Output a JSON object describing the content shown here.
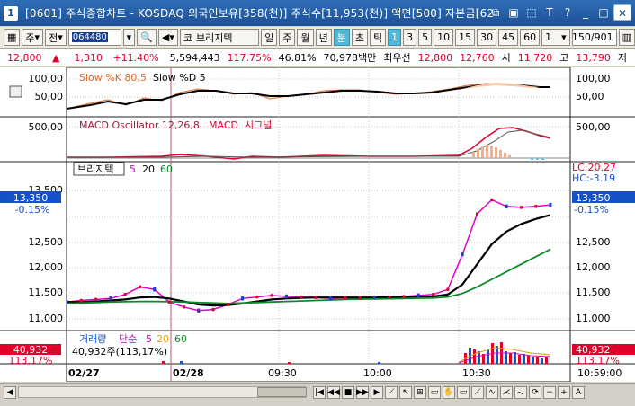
{
  "window": {
    "title": "[0601] 주식종합차트 - KOSDAQ 외국인보유[358(천)] 주식수[11,953(천)] 액면[500] 자본금[62",
    "icon_label": "1"
  },
  "toolbar": {
    "market": "주",
    "all": "전",
    "code": "064480",
    "stock_name": "브리지텍",
    "market_prefix": "코",
    "periods": [
      "일",
      "주",
      "월",
      "년",
      "분",
      "초",
      "틱"
    ],
    "selected_period": "분",
    "intervals": [
      "1",
      "3",
      "5",
      "10",
      "15",
      "30",
      "45",
      "60"
    ],
    "selected_interval": "1",
    "unit_select": "1",
    "page": "150/901"
  },
  "quote": {
    "price": "12,800",
    "price_arrow": "▲",
    "change": "1,310",
    "change_pct": "+11.40%",
    "volume": "5,594,443",
    "vol_ratio": "117.75%",
    "ratio2": "46.81%",
    "amount": "70,978백만",
    "best_label": "최우선",
    "best_ask": "12,800",
    "best_bid": "12,760",
    "open_label": "시",
    "open": "11,720",
    "high_label": "고",
    "high": "13,790",
    "cut_label": "저"
  },
  "colors": {
    "up": "#e0002a",
    "down": "#1d3fcc",
    "ma5": "#e000c8",
    "ma20": "#000000",
    "ma60": "#0a8a2a",
    "value_box": "#1552c7",
    "sep": "#b85a7a"
  },
  "stoch": {
    "label_k": "Slow %K 80,5",
    "label_d": "Slow %D 5",
    "ticks": [
      "100,00",
      "50,00"
    ]
  },
  "macd": {
    "label": "MACD Oscillator 12,26,8",
    "label_macd": "MACD",
    "label_signal": "시그널",
    "ticks": [
      "500,00"
    ]
  },
  "price_panel": {
    "stock": "브리지텍",
    "ma_labels": [
      "5",
      "20",
      "60"
    ],
    "ticks": [
      "13,500",
      "13,000",
      "12,500",
      "12,000",
      "11,500",
      "11,000"
    ],
    "current": "13,350",
    "current_pct": "-0.15%",
    "lc": "LC:20.27",
    "hc": "HC:-3.19"
  },
  "volume_panel": {
    "label": "거래량",
    "ma_label": "단순",
    "ma_values": [
      "5",
      "20",
      "60"
    ],
    "value_line": "40,932주(113,17%)",
    "current": "40,932",
    "current_pct": "113.17%"
  },
  "xaxis": {
    "date1": "02/27",
    "date2": "02/28",
    "t1": "09:30",
    "t2": "10:00",
    "t3": "10:30",
    "last": "10:59:00"
  },
  "chart_data": {
    "type": "line",
    "title": "",
    "xlabel": "",
    "ylabel": "",
    "ylim": [
      10800,
      13800
    ],
    "series": [
      {
        "name": "5",
        "values": [
          11350,
          11380,
          11400,
          11420,
          11500,
          11650,
          11600,
          11350,
          11250,
          11180,
          11200,
          11300,
          11420,
          11450,
          11480,
          11460,
          11450,
          11440,
          11420,
          11430,
          11430,
          11440,
          11450,
          11460,
          11480,
          11500,
          11600,
          12300,
          13100,
          13380,
          13250,
          13230,
          13250,
          13280
        ]
      },
      {
        "name": "20",
        "values": [
          11350,
          11350,
          11360,
          11380,
          11400,
          11440,
          11450,
          11420,
          11360,
          11300,
          11280,
          11290,
          11320,
          11360,
          11400,
          11420,
          11430,
          11440,
          11440,
          11440,
          11440,
          11440,
          11445,
          11450,
          11455,
          11460,
          11500,
          11700,
          12100,
          12500,
          12750,
          12900,
          13000,
          13080
        ]
      },
      {
        "name": "60",
        "values": [
          11320,
          11330,
          11340,
          11350,
          11355,
          11360,
          11360,
          11355,
          11350,
          11340,
          11330,
          11320,
          11330,
          11340,
          11350,
          11360,
          11370,
          11380,
          11390,
          11400,
          11405,
          11410,
          11415,
          11420,
          11425,
          11430,
          11450,
          11520,
          11650,
          11800,
          11950,
          12100,
          12250,
          12400
        ]
      }
    ]
  }
}
